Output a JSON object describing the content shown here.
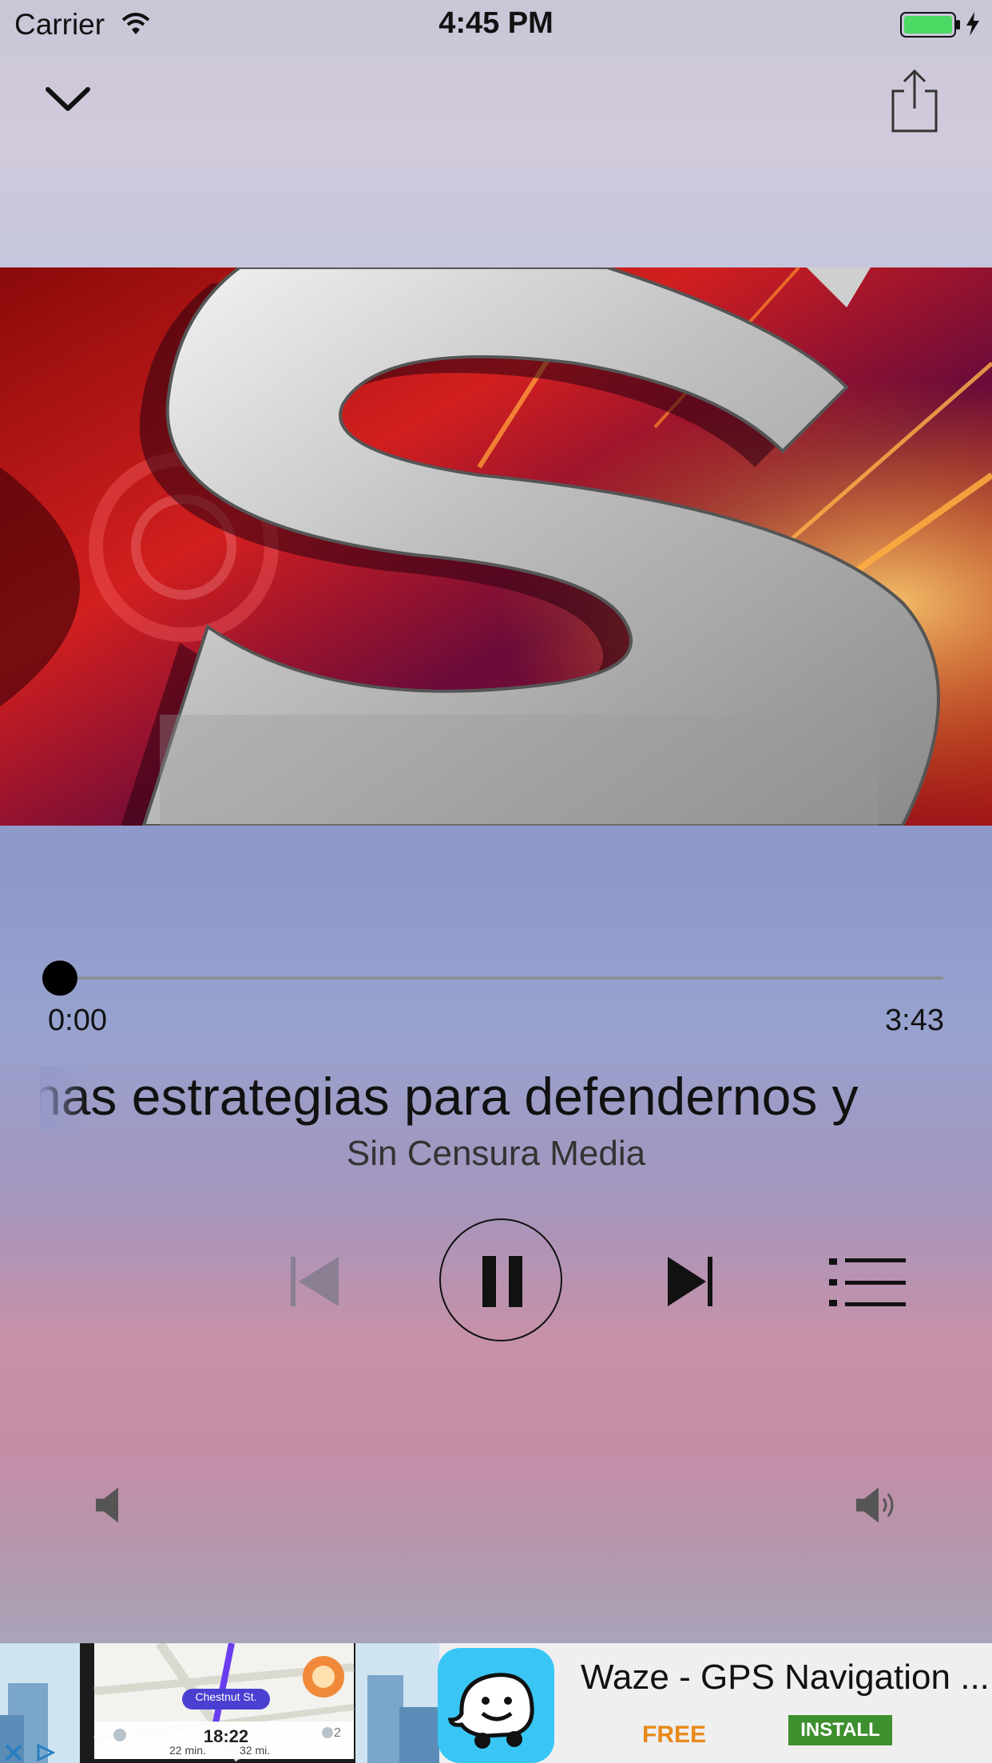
{
  "status_bar": {
    "carrier": "Carrier",
    "time": "4:45 PM"
  },
  "player": {
    "elapsed": "0:00",
    "duration": "3:43",
    "progress": 0,
    "title": "has estrategias para defendernos y",
    "artist": "Sin Censura Media"
  },
  "ad": {
    "title": "Waze - GPS Navigation ...",
    "price": "FREE",
    "install_label": "INSTALL",
    "map_street": "Chestnut St.",
    "map_time": "18:22",
    "map_eta": "22 min.",
    "map_distance": "32 mi.",
    "map_passengers": "2"
  },
  "colors": {
    "accent": "#000000",
    "ad_price": "#e8891a",
    "ad_install": "#3e8f2e"
  }
}
